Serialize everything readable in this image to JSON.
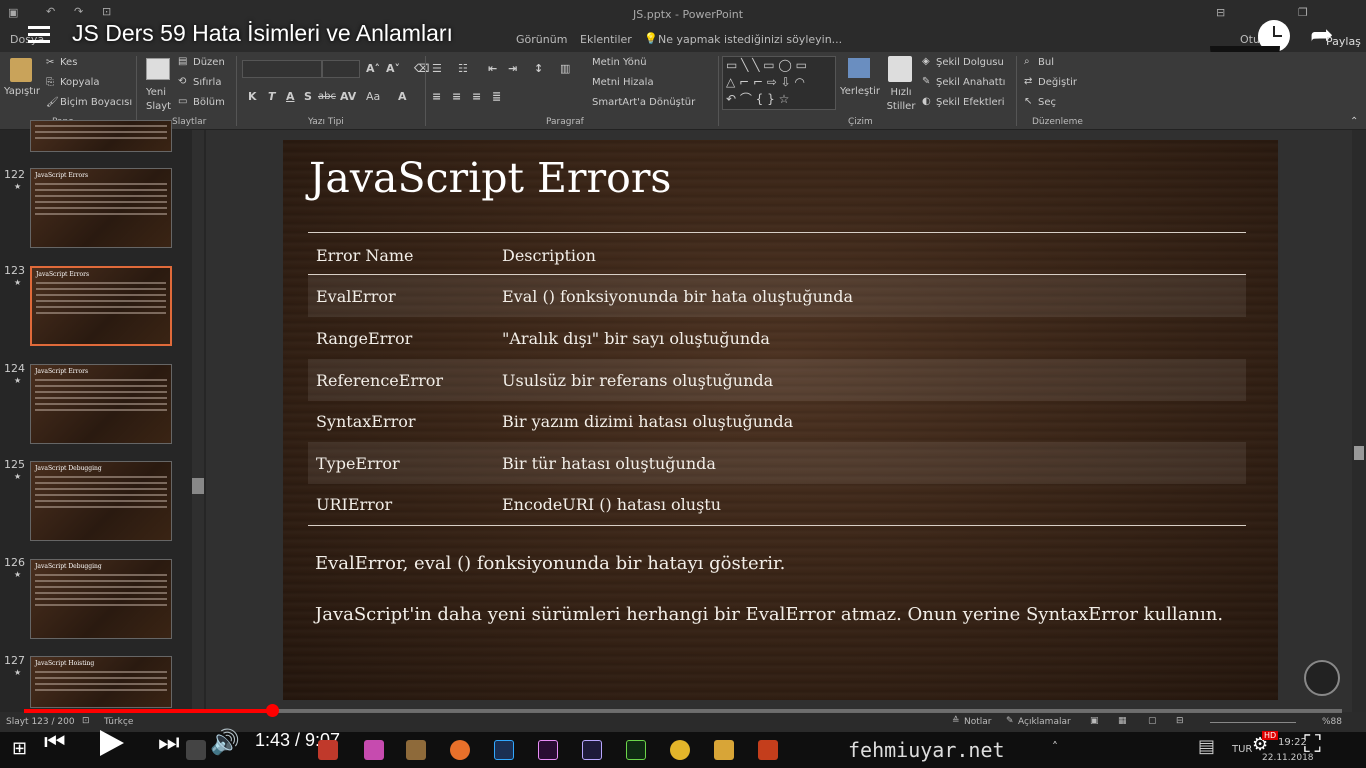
{
  "window": {
    "title": "JS.pptx - PowerPoint"
  },
  "video": {
    "title": "JS Ders 59 Hata İsimleri ve Anlamları",
    "time": "1:43 / 9:07",
    "progress": 0.19,
    "watermark": "fehmiuyar.net",
    "hd_badge": "HD",
    "share_label": "Paylaş"
  },
  "menu": {
    "items": [
      "Dosya",
      "Görünüm",
      "Eklentiler"
    ],
    "tell_me": "Ne yapmak istediğinizi söyleyin...",
    "user": "Otu"
  },
  "ribbon": {
    "pano": {
      "paste": "Yapıştır",
      "cut": "Kes",
      "copy": "Kopyala",
      "format_painter": "Biçim Boyacısı",
      "label": "Pano"
    },
    "slaytlar": {
      "new_slide": "Yeni Slayt",
      "layout": "Düzen",
      "reset": "Sıfırla",
      "section": "Bölüm",
      "label": "Slaytlar"
    },
    "yazi_tipi": {
      "label": "Yazı Tipi",
      "buttons": [
        "K",
        "T",
        "A",
        "S",
        "abc",
        "AV",
        "Aa",
        "A"
      ]
    },
    "paragraf": {
      "text_dir": "Metin Yönü",
      "align_text": "Metni Hizala",
      "smartart": "SmartArt'a Dönüştür",
      "label": "Paragraf"
    },
    "cizim": {
      "arrange": "Yerleştir",
      "quick_styles": "Hızlı Stiller",
      "fill": "Şekil Dolgusu",
      "outline": "Şekil Anahattı",
      "effects": "Şekil Efektleri",
      "label": "Çizim"
    },
    "duzenleme": {
      "find": "Bul",
      "replace": "Değiştir",
      "select": "Seç",
      "label": "Düzenleme"
    }
  },
  "thumbnails": [
    {
      "num": "",
      "title": ""
    },
    {
      "num": "122",
      "title": "JavaScript Errors"
    },
    {
      "num": "123",
      "title": "JavaScript Errors",
      "selected": true
    },
    {
      "num": "124",
      "title": "JavaScript Errors"
    },
    {
      "num": "125",
      "title": "JavaScript Debugging"
    },
    {
      "num": "126",
      "title": "JavaScript Debugging"
    },
    {
      "num": "127",
      "title": "JavaScript Hoisting"
    }
  ],
  "slide": {
    "title": "JavaScript Errors",
    "table": {
      "headers": [
        "Error Name",
        "Description"
      ],
      "rows": [
        [
          "EvalError",
          "Eval () fonksiyonunda bir hata oluştuğunda"
        ],
        [
          "RangeError",
          "\"Aralık dışı\" bir sayı oluştuğunda"
        ],
        [
          "ReferenceError",
          "Usulsüz bir referans oluştuğunda"
        ],
        [
          "SyntaxError",
          "Bir yazım dizimi hatası oluştuğunda"
        ],
        [
          "TypeError",
          "Bir tür hatası oluştuğunda"
        ],
        [
          "URIError",
          "EncodeURI () hatası oluştu"
        ]
      ]
    },
    "para1": "EvalError, eval () fonksiyonunda bir hatayı gösterir.",
    "para2": "JavaScript'in daha yeni sürümleri herhangi bir EvalError atmaz. Onun yerine SyntaxError kullanın."
  },
  "status": {
    "slide": "Slayt 123 / 200",
    "language": "Türkçe",
    "notes": "Notlar",
    "comments": "Açıklamalar",
    "zoom": "%88"
  },
  "taskbar": {
    "lang": "TUR",
    "clock": "19:22",
    "date": "22.11.2018"
  }
}
